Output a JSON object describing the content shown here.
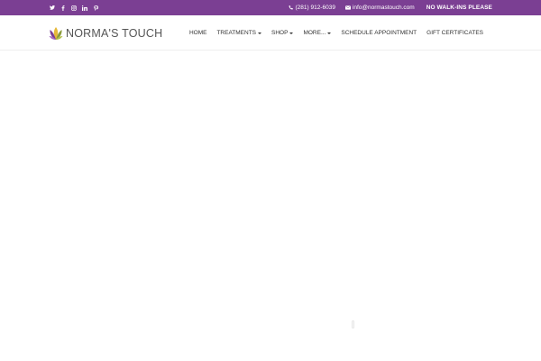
{
  "topbar": {
    "background": "#7b3f93",
    "social": [
      {
        "icon": "twitter-icon"
      },
      {
        "icon": "facebook-icon"
      },
      {
        "icon": "instagram-icon"
      },
      {
        "icon": "linkedin-icon"
      },
      {
        "icon": "pinterest-icon"
      }
    ],
    "phone": "(281) 912-6039",
    "email": "info@normastouch.com",
    "notice": "NO WALK-INS PLEASE"
  },
  "header": {
    "logo_text": "NORMA'S TOUCH",
    "nav": [
      {
        "label": "HOME",
        "dropdown": false
      },
      {
        "label": "TREATMENTS",
        "dropdown": true
      },
      {
        "label": "SHOP",
        "dropdown": true
      },
      {
        "label": "MORE...",
        "dropdown": true
      },
      {
        "label": "SCHEDULE APPOINTMENT",
        "dropdown": false
      },
      {
        "label": "GIFT CERTIFICATES",
        "dropdown": false
      }
    ]
  }
}
